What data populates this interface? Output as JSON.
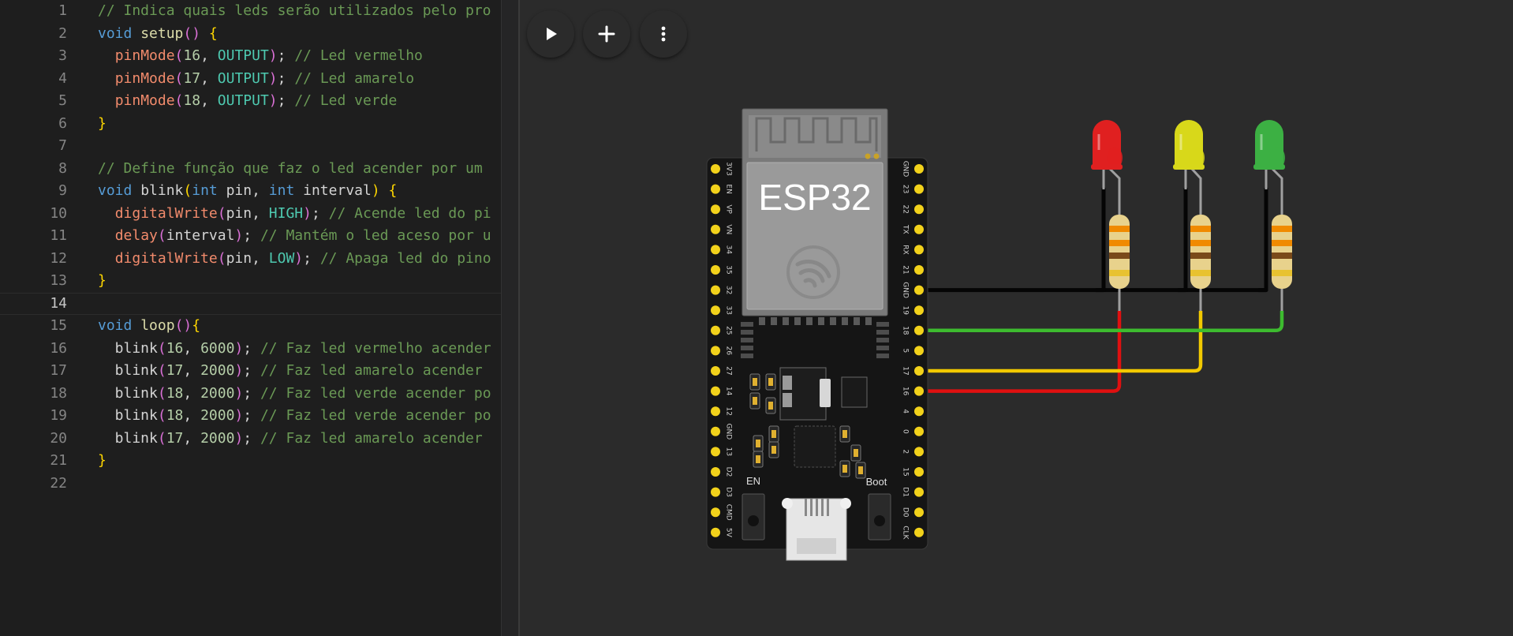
{
  "editor": {
    "lines": [
      {
        "n": "1",
        "tokens": [
          {
            "t": "// Indica quais leds serão utilizados pelo pro",
            "c": "tok-c"
          }
        ]
      },
      {
        "n": "2",
        "tokens": [
          {
            "t": "void",
            "c": "tok-k"
          },
          {
            "t": " ",
            "c": "tok-t"
          },
          {
            "t": "setup",
            "c": "tok-fn"
          },
          {
            "t": "()",
            "c": "tok-b2"
          },
          {
            "t": " ",
            "c": "tok-t"
          },
          {
            "t": "{",
            "c": "tok-b1"
          }
        ]
      },
      {
        "n": "3",
        "tokens": [
          {
            "t": "  ",
            "c": "tok-t"
          },
          {
            "t": "pinMode",
            "c": "tok-call"
          },
          {
            "t": "(",
            "c": "tok-b2"
          },
          {
            "t": "16",
            "c": "tok-n"
          },
          {
            "t": ", ",
            "c": "tok-t"
          },
          {
            "t": "OUTPUT",
            "c": "tok-const"
          },
          {
            "t": ")",
            "c": "tok-b2"
          },
          {
            "t": "; ",
            "c": "tok-t"
          },
          {
            "t": "// Led vermelho",
            "c": "tok-c"
          }
        ]
      },
      {
        "n": "4",
        "tokens": [
          {
            "t": "  ",
            "c": "tok-t"
          },
          {
            "t": "pinMode",
            "c": "tok-call"
          },
          {
            "t": "(",
            "c": "tok-b2"
          },
          {
            "t": "17",
            "c": "tok-n"
          },
          {
            "t": ", ",
            "c": "tok-t"
          },
          {
            "t": "OUTPUT",
            "c": "tok-const"
          },
          {
            "t": ")",
            "c": "tok-b2"
          },
          {
            "t": "; ",
            "c": "tok-t"
          },
          {
            "t": "// Led amarelo",
            "c": "tok-c"
          }
        ]
      },
      {
        "n": "5",
        "tokens": [
          {
            "t": "  ",
            "c": "tok-t"
          },
          {
            "t": "pinMode",
            "c": "tok-call"
          },
          {
            "t": "(",
            "c": "tok-b2"
          },
          {
            "t": "18",
            "c": "tok-n"
          },
          {
            "t": ", ",
            "c": "tok-t"
          },
          {
            "t": "OUTPUT",
            "c": "tok-const"
          },
          {
            "t": ")",
            "c": "tok-b2"
          },
          {
            "t": "; ",
            "c": "tok-t"
          },
          {
            "t": "// Led verde",
            "c": "tok-c"
          }
        ]
      },
      {
        "n": "6",
        "tokens": [
          {
            "t": "}",
            "c": "tok-b1"
          }
        ]
      },
      {
        "n": "7",
        "tokens": []
      },
      {
        "n": "8",
        "tokens": [
          {
            "t": "// Define função que faz o led acender por um ",
            "c": "tok-c"
          }
        ]
      },
      {
        "n": "9",
        "tokens": [
          {
            "t": "void",
            "c": "tok-k"
          },
          {
            "t": " blink",
            "c": "tok-t"
          },
          {
            "t": "(",
            "c": "tok-b1"
          },
          {
            "t": "int",
            "c": "tok-k"
          },
          {
            "t": " pin, ",
            "c": "tok-t"
          },
          {
            "t": "int",
            "c": "tok-k"
          },
          {
            "t": " interval",
            "c": "tok-t"
          },
          {
            "t": ")",
            "c": "tok-b1"
          },
          {
            "t": " ",
            "c": "tok-t"
          },
          {
            "t": "{",
            "c": "tok-b1"
          }
        ]
      },
      {
        "n": "10",
        "tokens": [
          {
            "t": "  ",
            "c": "tok-t"
          },
          {
            "t": "digitalWrite",
            "c": "tok-call"
          },
          {
            "t": "(",
            "c": "tok-b2"
          },
          {
            "t": "pin, ",
            "c": "tok-t"
          },
          {
            "t": "HIGH",
            "c": "tok-const"
          },
          {
            "t": ")",
            "c": "tok-b2"
          },
          {
            "t": "; ",
            "c": "tok-t"
          },
          {
            "t": "// Acende led do pi",
            "c": "tok-c"
          }
        ]
      },
      {
        "n": "11",
        "tokens": [
          {
            "t": "  ",
            "c": "tok-t"
          },
          {
            "t": "delay",
            "c": "tok-call"
          },
          {
            "t": "(",
            "c": "tok-b2"
          },
          {
            "t": "interval",
            "c": "tok-t"
          },
          {
            "t": ")",
            "c": "tok-b2"
          },
          {
            "t": "; ",
            "c": "tok-t"
          },
          {
            "t": "// Mantém o led aceso por u",
            "c": "tok-c"
          }
        ]
      },
      {
        "n": "12",
        "tokens": [
          {
            "t": "  ",
            "c": "tok-t"
          },
          {
            "t": "digitalWrite",
            "c": "tok-call"
          },
          {
            "t": "(",
            "c": "tok-b2"
          },
          {
            "t": "pin, ",
            "c": "tok-t"
          },
          {
            "t": "LOW",
            "c": "tok-const"
          },
          {
            "t": ")",
            "c": "tok-b2"
          },
          {
            "t": "; ",
            "c": "tok-t"
          },
          {
            "t": "// Apaga led do pino",
            "c": "tok-c"
          }
        ]
      },
      {
        "n": "13",
        "tokens": [
          {
            "t": "}",
            "c": "tok-b1"
          }
        ]
      },
      {
        "n": "14",
        "tokens": [],
        "current": true
      },
      {
        "n": "15",
        "tokens": [
          {
            "t": "void",
            "c": "tok-k"
          },
          {
            "t": " ",
            "c": "tok-t"
          },
          {
            "t": "loop",
            "c": "tok-fn"
          },
          {
            "t": "()",
            "c": "tok-b2"
          },
          {
            "t": "{",
            "c": "tok-b1"
          }
        ]
      },
      {
        "n": "16",
        "tokens": [
          {
            "t": "  blink",
            "c": "tok-t"
          },
          {
            "t": "(",
            "c": "tok-b2"
          },
          {
            "t": "16",
            "c": "tok-n"
          },
          {
            "t": ", ",
            "c": "tok-t"
          },
          {
            "t": "6000",
            "c": "tok-n"
          },
          {
            "t": ")",
            "c": "tok-b2"
          },
          {
            "t": "; ",
            "c": "tok-t"
          },
          {
            "t": "// Faz led vermelho acender",
            "c": "tok-c"
          }
        ]
      },
      {
        "n": "17",
        "tokens": [
          {
            "t": "  blink",
            "c": "tok-t"
          },
          {
            "t": "(",
            "c": "tok-b2"
          },
          {
            "t": "17",
            "c": "tok-n"
          },
          {
            "t": ", ",
            "c": "tok-t"
          },
          {
            "t": "2000",
            "c": "tok-n"
          },
          {
            "t": ")",
            "c": "tok-b2"
          },
          {
            "t": "; ",
            "c": "tok-t"
          },
          {
            "t": "// Faz led amarelo acender ",
            "c": "tok-c"
          }
        ]
      },
      {
        "n": "18",
        "tokens": [
          {
            "t": "  blink",
            "c": "tok-t"
          },
          {
            "t": "(",
            "c": "tok-b2"
          },
          {
            "t": "18",
            "c": "tok-n"
          },
          {
            "t": ", ",
            "c": "tok-t"
          },
          {
            "t": "2000",
            "c": "tok-n"
          },
          {
            "t": ")",
            "c": "tok-b2"
          },
          {
            "t": "; ",
            "c": "tok-t"
          },
          {
            "t": "// Faz led verde acender po",
            "c": "tok-c"
          }
        ]
      },
      {
        "n": "19",
        "tokens": [
          {
            "t": "  blink",
            "c": "tok-t"
          },
          {
            "t": "(",
            "c": "tok-b2"
          },
          {
            "t": "18",
            "c": "tok-n"
          },
          {
            "t": ", ",
            "c": "tok-t"
          },
          {
            "t": "2000",
            "c": "tok-n"
          },
          {
            "t": ")",
            "c": "tok-b2"
          },
          {
            "t": "; ",
            "c": "tok-t"
          },
          {
            "t": "// Faz led verde acender po",
            "c": "tok-c"
          }
        ]
      },
      {
        "n": "20",
        "tokens": [
          {
            "t": "  blink",
            "c": "tok-t"
          },
          {
            "t": "(",
            "c": "tok-b2"
          },
          {
            "t": "17",
            "c": "tok-n"
          },
          {
            "t": ", ",
            "c": "tok-t"
          },
          {
            "t": "2000",
            "c": "tok-n"
          },
          {
            "t": ")",
            "c": "tok-b2"
          },
          {
            "t": "; ",
            "c": "tok-t"
          },
          {
            "t": "// Faz led amarelo acender ",
            "c": "tok-c"
          }
        ]
      },
      {
        "n": "21",
        "tokens": [
          {
            "t": "}",
            "c": "tok-b1"
          }
        ]
      },
      {
        "n": "22",
        "tokens": []
      }
    ]
  },
  "toolbar": {
    "play": {
      "icon": "play-icon",
      "color": "#2e9c3f"
    },
    "add": {
      "icon": "plus-icon",
      "color": "#1e6fd0"
    },
    "more": {
      "icon": "vertical-dots-icon",
      "color": "#6e6e6e"
    }
  },
  "board": {
    "chip_label": "ESP32",
    "en_label": "EN",
    "boot_label": "Boot",
    "left_pins": [
      "3V3",
      "EN",
      "VP",
      "VN",
      "34",
      "35",
      "32",
      "33",
      "25",
      "26",
      "27",
      "14",
      "12",
      "GND",
      "13",
      "D2",
      "D3",
      "CMD",
      "5V"
    ],
    "right_pins": [
      "GND",
      "23",
      "22",
      "TX",
      "RX",
      "21",
      "GND",
      "19",
      "18",
      "5",
      "17",
      "16",
      "4",
      "0",
      "2",
      "15",
      "D1",
      "D0",
      "CLK"
    ]
  },
  "leds": [
    {
      "color": "red",
      "pin": "16",
      "fill": "#e02020"
    },
    {
      "color": "yellow",
      "pin": "17",
      "fill": "#d8d81a"
    },
    {
      "color": "green",
      "pin": "18",
      "fill": "#3cb043"
    }
  ]
}
